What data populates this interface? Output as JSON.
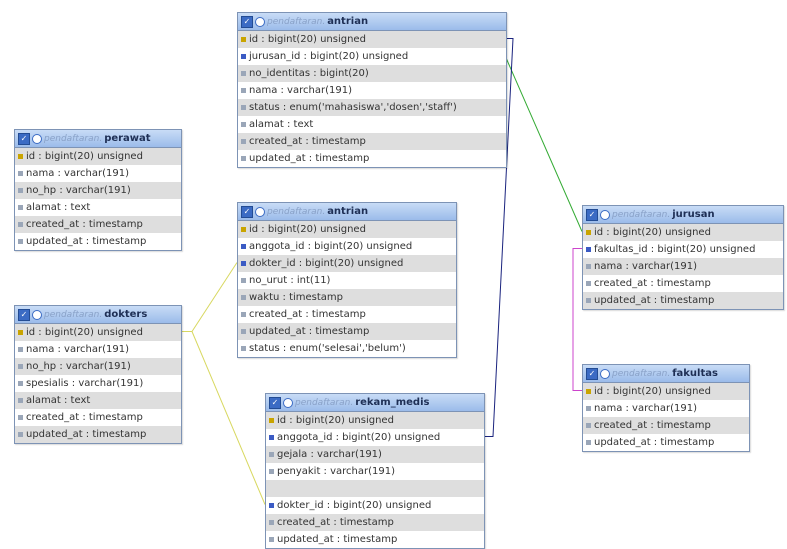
{
  "diagram": {
    "schema_label": "pendaftaran",
    "colors": {
      "header_start": "#c8dcf6",
      "header_end": "#9bbbea",
      "line_green": "#33aa33",
      "line_yellow": "#d8d860",
      "line_navy": "#1a237e",
      "line_purple": "#cc44cc"
    },
    "tables": [
      {
        "id": "antrian",
        "name": "antrian",
        "columns": [
          {
            "text": "id : bigint(20) unsigned",
            "key": "pk"
          },
          {
            "text": "jurusan_id : bigint(20) unsigned",
            "key": "fk"
          },
          {
            "text": "no_identitas : bigint(20)",
            "key": ""
          },
          {
            "text": "nama : varchar(191)",
            "key": ""
          },
          {
            "text": "status : enum('mahasiswa','dosen','staff')",
            "key": ""
          },
          {
            "text": "alamat : text",
            "key": ""
          },
          {
            "text": "created_at : timestamp",
            "key": ""
          },
          {
            "text": "updated_at : timestamp",
            "key": ""
          }
        ]
      },
      {
        "id": "perawat",
        "name": "perawat",
        "columns": [
          {
            "text": "id : bigint(20) unsigned",
            "key": "pk"
          },
          {
            "text": "nama : varchar(191)",
            "key": ""
          },
          {
            "text": "no_hp : varchar(191)",
            "key": ""
          },
          {
            "text": "alamat : text",
            "key": ""
          },
          {
            "text": "created_at : timestamp",
            "key": ""
          },
          {
            "text": "updated_at : timestamp",
            "key": ""
          }
        ]
      },
      {
        "id": "antrian2",
        "name": "antrian",
        "columns": [
          {
            "text": "id : bigint(20) unsigned",
            "key": "pk"
          },
          {
            "text": "anggota_id : bigint(20) unsigned",
            "key": "fk"
          },
          {
            "text": "dokter_id : bigint(20) unsigned",
            "key": "fk"
          },
          {
            "text": "no_urut : int(11)",
            "key": ""
          },
          {
            "text": "waktu : timestamp",
            "key": ""
          },
          {
            "text": "created_at : timestamp",
            "key": ""
          },
          {
            "text": "updated_at : timestamp",
            "key": ""
          },
          {
            "text": "status : enum('selesai','belum')",
            "key": ""
          }
        ]
      },
      {
        "id": "dokters",
        "name": "dokters",
        "columns": [
          {
            "text": "id : bigint(20) unsigned",
            "key": "pk"
          },
          {
            "text": "nama : varchar(191)",
            "key": ""
          },
          {
            "text": "no_hp : varchar(191)",
            "key": ""
          },
          {
            "text": "spesialis : varchar(191)",
            "key": ""
          },
          {
            "text": "alamat : text",
            "key": ""
          },
          {
            "text": "created_at : timestamp",
            "key": ""
          },
          {
            "text": "updated_at : timestamp",
            "key": ""
          }
        ]
      },
      {
        "id": "rekam_medis",
        "name": "rekam_medis",
        "columns": [
          {
            "text": "id : bigint(20) unsigned",
            "key": "pk"
          },
          {
            "text": "anggota_id : bigint(20) unsigned",
            "key": "fk"
          },
          {
            "text": "gejala : varchar(191)",
            "key": ""
          },
          {
            "text": "penyakit : varchar(191)",
            "key": ""
          },
          {
            "text": "",
            "key": ""
          },
          {
            "text": "dokter_id : bigint(20) unsigned",
            "key": "fk"
          },
          {
            "text": "created_at : timestamp",
            "key": ""
          },
          {
            "text": "updated_at : timestamp",
            "key": ""
          }
        ]
      },
      {
        "id": "jurusan",
        "name": "jurusan",
        "columns": [
          {
            "text": "id : bigint(20) unsigned",
            "key": "pk"
          },
          {
            "text": "fakultas_id : bigint(20) unsigned",
            "key": "fk"
          },
          {
            "text": "nama : varchar(191)",
            "key": ""
          },
          {
            "text": "created_at : timestamp",
            "key": ""
          },
          {
            "text": "updated_at : timestamp",
            "key": ""
          }
        ]
      },
      {
        "id": "fakultas",
        "name": "fakultas",
        "columns": [
          {
            "text": "id : bigint(20) unsigned",
            "key": "pk"
          },
          {
            "text": "nama : varchar(191)",
            "key": ""
          },
          {
            "text": "created_at : timestamp",
            "key": ""
          },
          {
            "text": "updated_at : timestamp",
            "key": ""
          }
        ]
      }
    ]
  }
}
